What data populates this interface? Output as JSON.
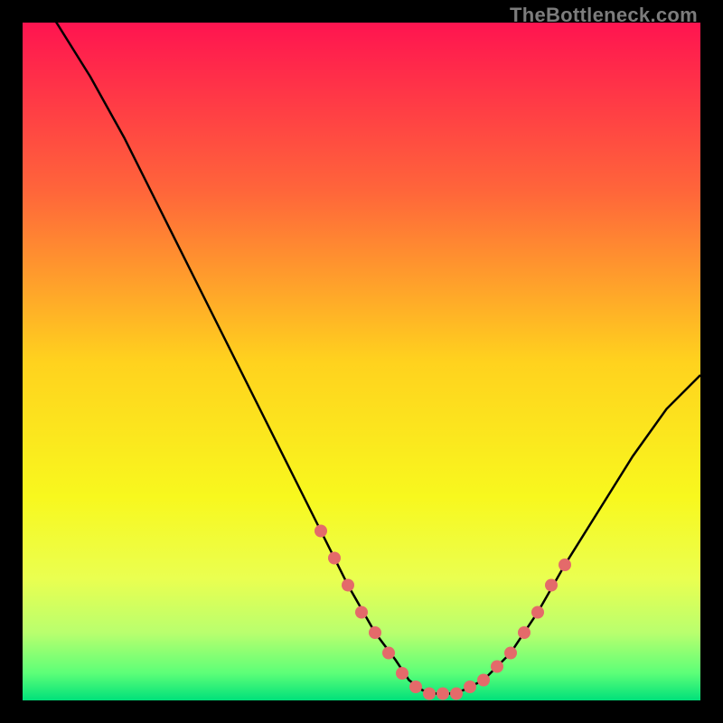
{
  "watermark": "TheBottleneck.com",
  "chart_data": {
    "type": "line",
    "title": "",
    "xlabel": "",
    "ylabel": "",
    "xlim": [
      0,
      100
    ],
    "ylim": [
      0,
      100
    ],
    "gradient_stops": [
      {
        "offset": 0,
        "color": "#ff1450"
      },
      {
        "offset": 25,
        "color": "#ff663a"
      },
      {
        "offset": 50,
        "color": "#ffd21e"
      },
      {
        "offset": 70,
        "color": "#f8f81e"
      },
      {
        "offset": 82,
        "color": "#eaff50"
      },
      {
        "offset": 90,
        "color": "#b9ff6e"
      },
      {
        "offset": 96,
        "color": "#5cff78"
      },
      {
        "offset": 100,
        "color": "#00e07a"
      }
    ],
    "series": [
      {
        "name": "bottleneck-curve",
        "x": [
          0,
          5,
          10,
          15,
          20,
          25,
          30,
          35,
          40,
          44,
          48,
          52,
          55,
          57,
          59,
          61,
          63,
          65,
          68,
          72,
          76,
          80,
          85,
          90,
          95,
          100
        ],
        "values": [
          107,
          100,
          92,
          83,
          73,
          63,
          53,
          43,
          33,
          25,
          17,
          10,
          6,
          3,
          1.5,
          1,
          1,
          1.5,
          3,
          7,
          13,
          20,
          28,
          36,
          43,
          48
        ]
      }
    ],
    "markers": {
      "name": "highlight-dots",
      "color": "#e46a6a",
      "x": [
        44,
        46,
        48,
        50,
        52,
        54,
        56,
        58,
        60,
        62,
        64,
        66,
        68,
        70,
        72,
        74,
        76,
        78,
        80
      ],
      "values": [
        25,
        21,
        17,
        13,
        10,
        7,
        4,
        2,
        1,
        1,
        1,
        2,
        3,
        5,
        7,
        10,
        13,
        17,
        20
      ]
    }
  }
}
